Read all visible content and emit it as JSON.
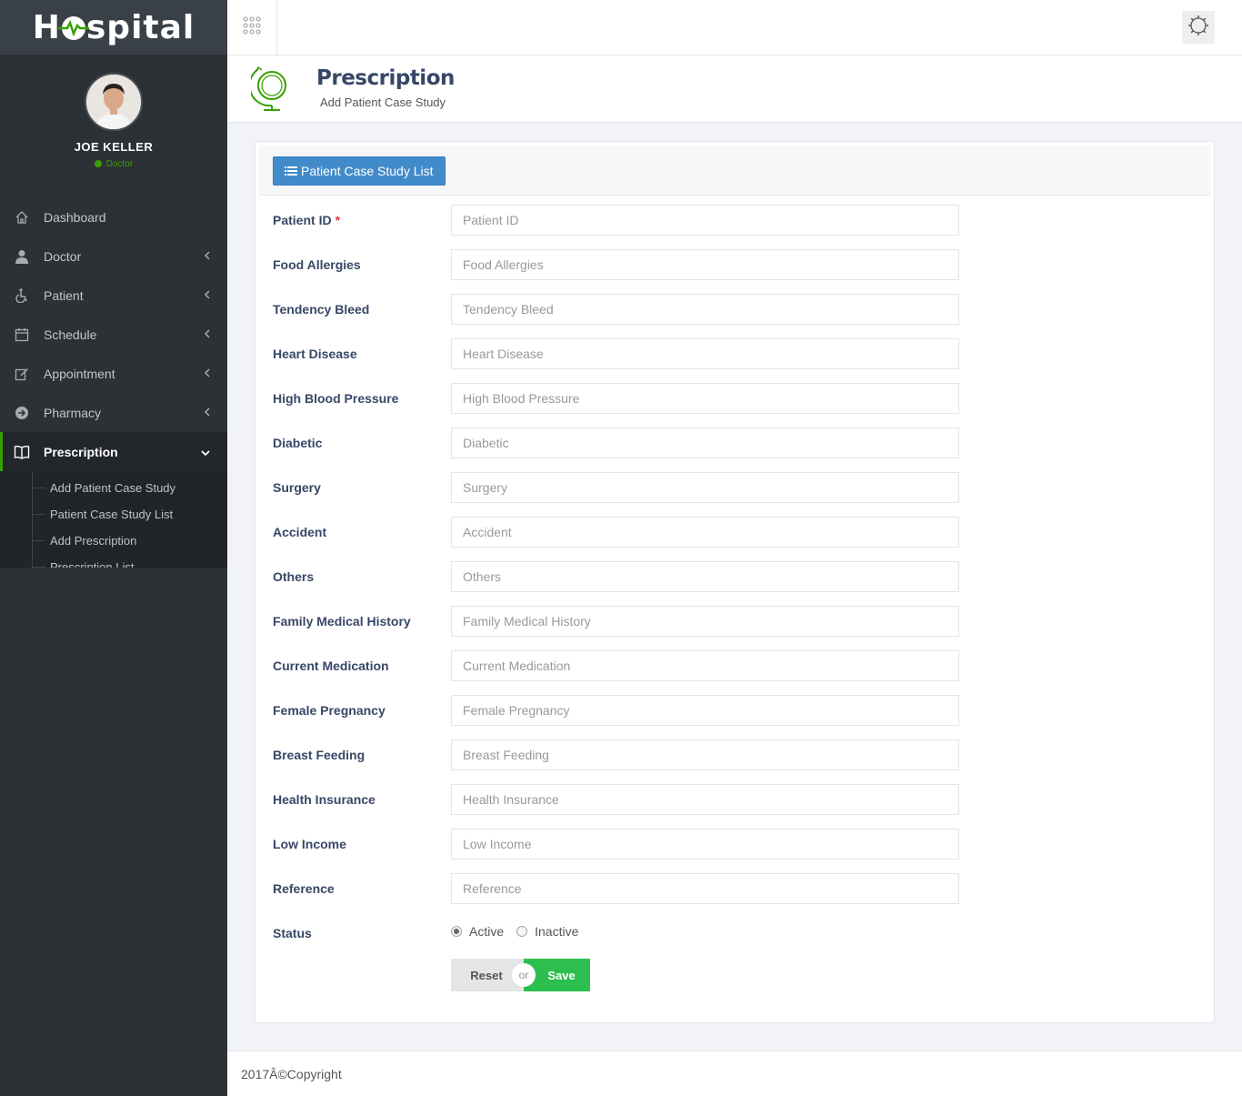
{
  "app": {
    "logo_text_pre": "H",
    "logo_text_post": "spital"
  },
  "user": {
    "name": "JOE KELLER",
    "role": "Doctor"
  },
  "sidebar": {
    "items": [
      {
        "label": "Dashboard",
        "icon": "home-icon"
      },
      {
        "label": "Doctor",
        "icon": "user-md-icon"
      },
      {
        "label": "Patient",
        "icon": "wheelchair-icon"
      },
      {
        "label": "Schedule",
        "icon": "calendar-icon"
      },
      {
        "label": "Appointment",
        "icon": "edit-icon"
      },
      {
        "label": "Pharmacy",
        "icon": "arrow-circle-icon"
      },
      {
        "label": "Prescription",
        "icon": "book-icon"
      }
    ],
    "subitems": [
      "Add Patient Case Study",
      "Patient Case Study List",
      "Add Prescription",
      "Prescription List"
    ]
  },
  "header": {
    "title": "Prescription",
    "subtitle": "Add Patient Case Study"
  },
  "panel": {
    "list_button": "Patient Case Study List"
  },
  "form": {
    "fields": [
      {
        "label": "Patient ID",
        "placeholder": "Patient ID",
        "required": "*"
      },
      {
        "label": "Food Allergies",
        "placeholder": "Food Allergies"
      },
      {
        "label": "Tendency Bleed",
        "placeholder": "Tendency Bleed"
      },
      {
        "label": "Heart Disease",
        "placeholder": "Heart Disease"
      },
      {
        "label": "High Blood Pressure",
        "placeholder": "High Blood Pressure"
      },
      {
        "label": "Diabetic",
        "placeholder": "Diabetic"
      },
      {
        "label": "Surgery",
        "placeholder": "Surgery"
      },
      {
        "label": "Accident",
        "placeholder": "Accident"
      },
      {
        "label": "Others",
        "placeholder": "Others"
      },
      {
        "label": "Family Medical History",
        "placeholder": "Family Medical History"
      },
      {
        "label": "Current Medication",
        "placeholder": "Current Medication"
      },
      {
        "label": "Female Pregnancy",
        "placeholder": "Female Pregnancy"
      },
      {
        "label": "Breast Feeding",
        "placeholder": "Breast Feeding"
      },
      {
        "label": "Health Insurance",
        "placeholder": "Health Insurance"
      },
      {
        "label": "Low Income",
        "placeholder": "Low Income"
      },
      {
        "label": "Reference",
        "placeholder": "Reference"
      }
    ],
    "status_label": "Status",
    "status_options": [
      "Active",
      "Inactive"
    ],
    "status_selected": "Active",
    "reset_label": "Reset",
    "or_label": "or",
    "save_label": "Save"
  },
  "footer": {
    "copyright": "2017Â©Copyright"
  },
  "colors": {
    "sidebar_bg": "#2c3136",
    "accent_green": "#37a000",
    "primary_blue": "#428bca",
    "save_green": "#2cbe4e"
  }
}
